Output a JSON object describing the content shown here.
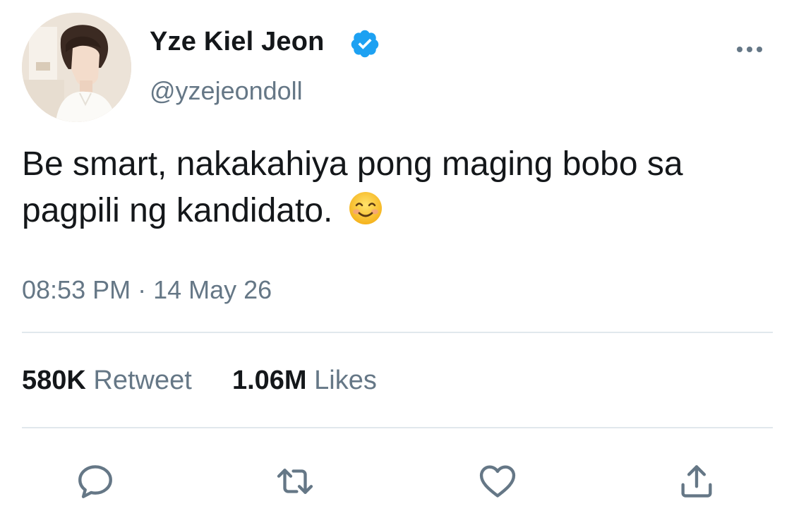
{
  "user": {
    "display_name": "Yze Kiel Jeon",
    "handle": "@yzejeondoll",
    "verified": true,
    "avatar_icon": "profile-photo"
  },
  "tweet": {
    "text": "Be smart, nakakahiya pong maging bobo sa pagpili ng kandidato.",
    "emoji": "smiling-face-icon",
    "timestamp": "08:53 PM · 14 May 26"
  },
  "stats": {
    "retweets_count": "580K",
    "retweets_label": "Retweet",
    "likes_count": "1.06M",
    "likes_label": "Likes"
  },
  "actions": [
    "reply-icon",
    "retweet-icon",
    "like-icon",
    "share-icon"
  ],
  "colors": {
    "text_primary": "#14171a",
    "text_secondary": "#657786",
    "verified_blue": "#1da1f2",
    "divider": "#e1e8ed"
  }
}
